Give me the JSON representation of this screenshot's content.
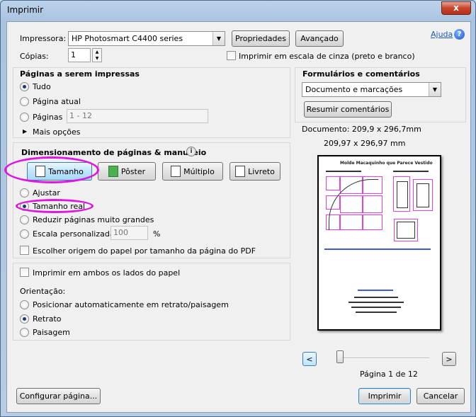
{
  "window": {
    "title": "Imprimir",
    "close_glyph": "x"
  },
  "printer": {
    "label": "Impressora:",
    "selected": "HP Photosmart C4400 series",
    "properties_button": "Propriedades",
    "advanced_button": "Avançado",
    "help_link": "Ajuda",
    "copies_label": "Cópias:",
    "copies_value": "1",
    "grayscale_label": "Imprimir em escala de cinza (preto e branco)"
  },
  "pages_to_print": {
    "title": "Páginas a serem impressas",
    "options": [
      "Tudo",
      "Página atual",
      "Páginas"
    ],
    "selected": "Tudo",
    "pages_range_value": "1 - 12",
    "more_options": "Mais opções"
  },
  "sizing": {
    "title": "Dimensionamento de páginas & manuseio",
    "tabs": [
      "Tamanho",
      "Pôster",
      "Múltiplo",
      "Livreto"
    ],
    "active_tab": "Tamanho",
    "options": [
      "Ajustar",
      "Tamanho real",
      "Reduzir páginas muito grandes",
      "Escala personalizada:"
    ],
    "selected": "Tamanho real",
    "custom_scale_value": "100",
    "percent_sign": "%",
    "paper_source_label": "Escolher origem do papel por tamanho da página do PDF"
  },
  "duplex": {
    "both_sides_label": "Imprimir em ambos os lados do papel",
    "orientation_label": "Orientação:",
    "options": [
      "Posicionar automaticamente em retrato/paisagem",
      "Retrato",
      "Paisagem"
    ],
    "selected": "Retrato"
  },
  "comments": {
    "title": "Formulários e comentários",
    "selected": "Documento e marcações",
    "summarize_button": "Resumir comentários"
  },
  "preview": {
    "document_size": "Documento: 209,9 x 296,7mm",
    "page_size": "209,97 x 296,97 mm",
    "page_title": "Molde Macaquinho que Parece Vestido",
    "page_indicator": "Página 1 de 12",
    "prev_glyph": "<",
    "next_glyph": ">"
  },
  "footer": {
    "page_setup_button": "Configurar página...",
    "print_button": "Imprimir",
    "cancel_button": "Cancelar"
  },
  "colors": {
    "annotation": "#e016e0",
    "accent": "#1a5ab5"
  }
}
